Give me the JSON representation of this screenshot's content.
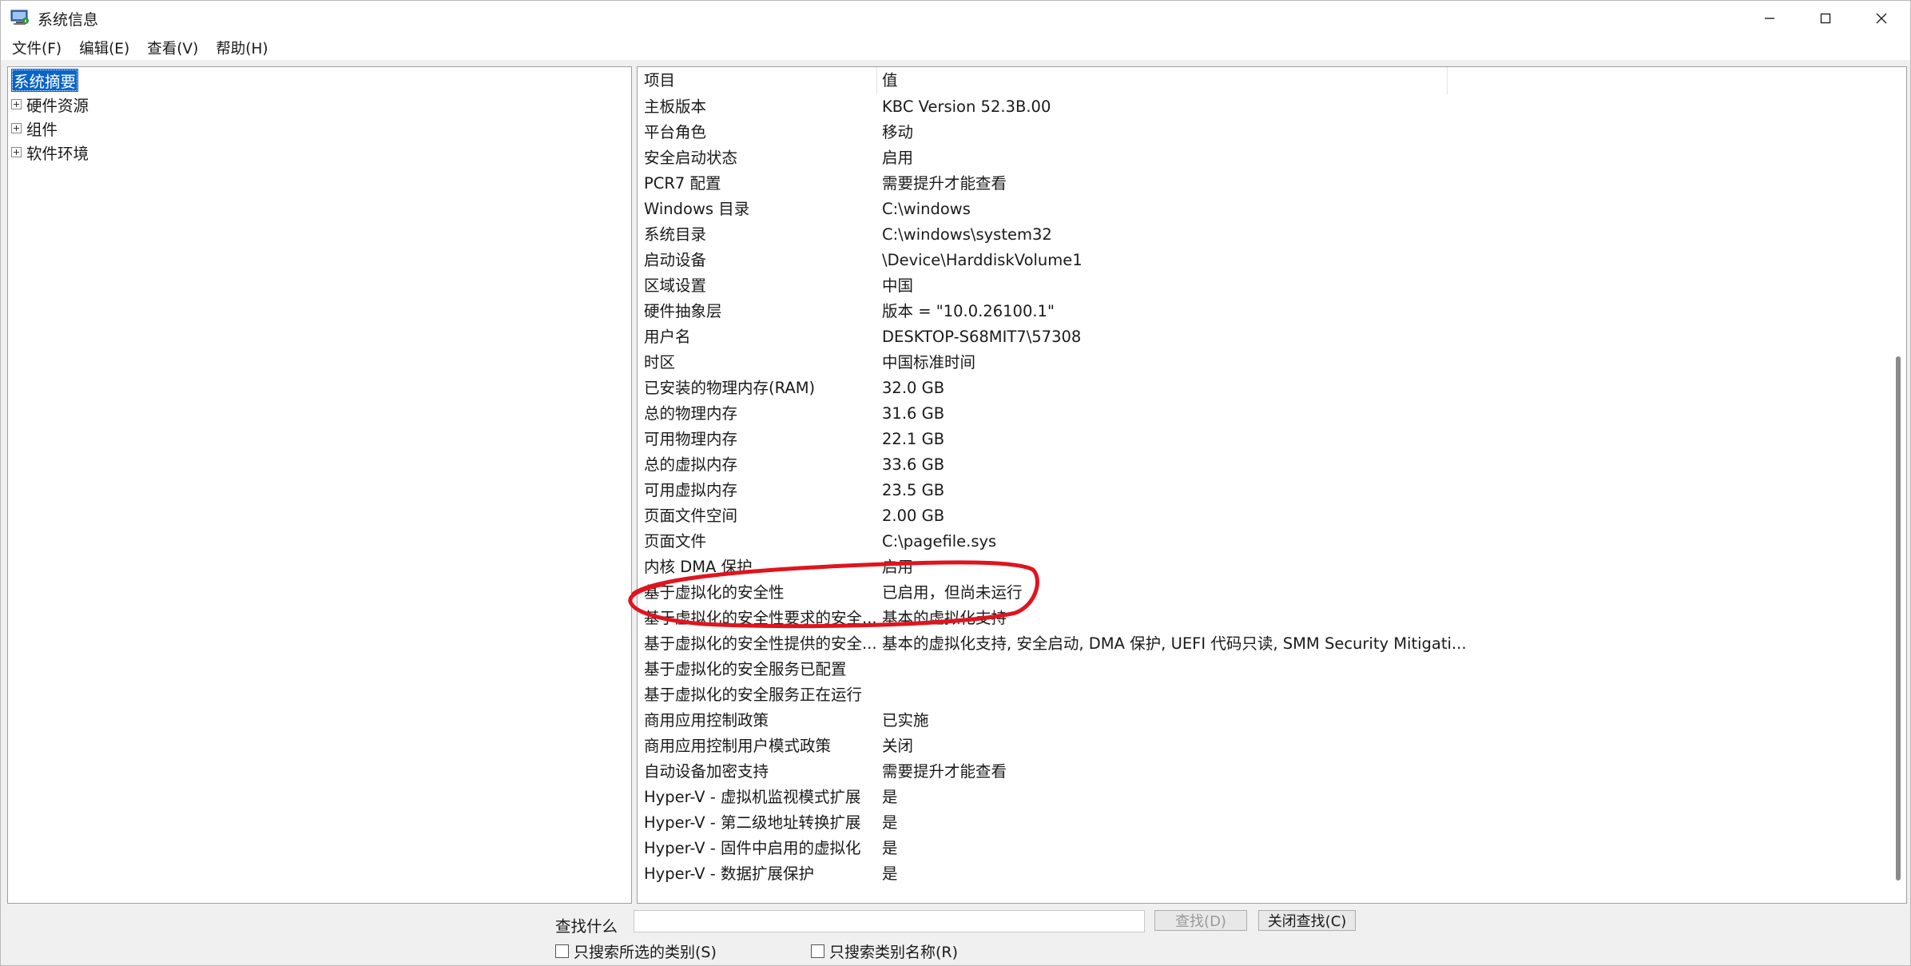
{
  "window": {
    "title": "系统信息",
    "controls": {
      "minimize": "—",
      "maximize": "☐",
      "close": "✕"
    }
  },
  "menu": [
    "文件(F)",
    "编辑(E)",
    "查看(V)",
    "帮助(H)"
  ],
  "tree": {
    "selected": "系统摘要",
    "children": [
      "硬件资源",
      "组件",
      "软件环境"
    ]
  },
  "table": {
    "headers": {
      "item": "项目",
      "value": "值"
    },
    "rows": [
      {
        "k": "主板版本",
        "v": "KBC Version 52.3B.00"
      },
      {
        "k": "平台角色",
        "v": "移动"
      },
      {
        "k": "安全启动状态",
        "v": "启用"
      },
      {
        "k": "PCR7 配置",
        "v": "需要提升才能查看"
      },
      {
        "k": "Windows 目录",
        "v": "C:\\windows"
      },
      {
        "k": "系统目录",
        "v": "C:\\windows\\system32"
      },
      {
        "k": "启动设备",
        "v": "\\Device\\HarddiskVolume1"
      },
      {
        "k": "区域设置",
        "v": "中国"
      },
      {
        "k": "硬件抽象层",
        "v": "版本 = \"10.0.26100.1\""
      },
      {
        "k": "用户名",
        "v": "DESKTOP-S68MIT7\\57308"
      },
      {
        "k": "时区",
        "v": "中国标准时间"
      },
      {
        "k": "已安装的物理内存(RAM)",
        "v": "32.0 GB"
      },
      {
        "k": "总的物理内存",
        "v": "31.6 GB"
      },
      {
        "k": "可用物理内存",
        "v": "22.1 GB"
      },
      {
        "k": "总的虚拟内存",
        "v": "33.6 GB"
      },
      {
        "k": "可用虚拟内存",
        "v": "23.5 GB"
      },
      {
        "k": "页面文件空间",
        "v": "2.00 GB"
      },
      {
        "k": "页面文件",
        "v": "C:\\pagefile.sys"
      },
      {
        "k": "内核 DMA 保护",
        "v": "启用"
      },
      {
        "k": "基于虚拟化的安全性",
        "v": "已启用，但尚未运行"
      },
      {
        "k": "基于虚拟化的安全性要求的安全...",
        "v": "基本的虚拟化支持"
      },
      {
        "k": "基于虚拟化的安全性提供的安全...",
        "v": "基本的虚拟化支持, 安全启动, DMA 保护, UEFI 代码只读, SMM Security Mitigati..."
      },
      {
        "k": "基于虚拟化的安全服务已配置",
        "v": ""
      },
      {
        "k": "基于虚拟化的安全服务正在运行",
        "v": ""
      },
      {
        "k": "商用应用控制政策",
        "v": "已实施"
      },
      {
        "k": "商用应用控制用户模式政策",
        "v": "关闭"
      },
      {
        "k": "自动设备加密支持",
        "v": "需要提升才能查看"
      },
      {
        "k": "Hyper-V - 虚拟机监视模式扩展",
        "v": "是"
      },
      {
        "k": "Hyper-V - 第二级地址转换扩展",
        "v": "是"
      },
      {
        "k": "Hyper-V - 固件中启用的虚拟化",
        "v": "是"
      },
      {
        "k": "Hyper-V - 数据扩展保护",
        "v": "是"
      }
    ]
  },
  "annotation": {
    "color": "#e0141e"
  },
  "find": {
    "label": "查找什么",
    "value": "",
    "find_button": "查找(D)",
    "close_button": "关闭查找(C)",
    "check_selected": "只搜索所选的类别(S)",
    "check_names": "只搜索类别名称(R)"
  }
}
